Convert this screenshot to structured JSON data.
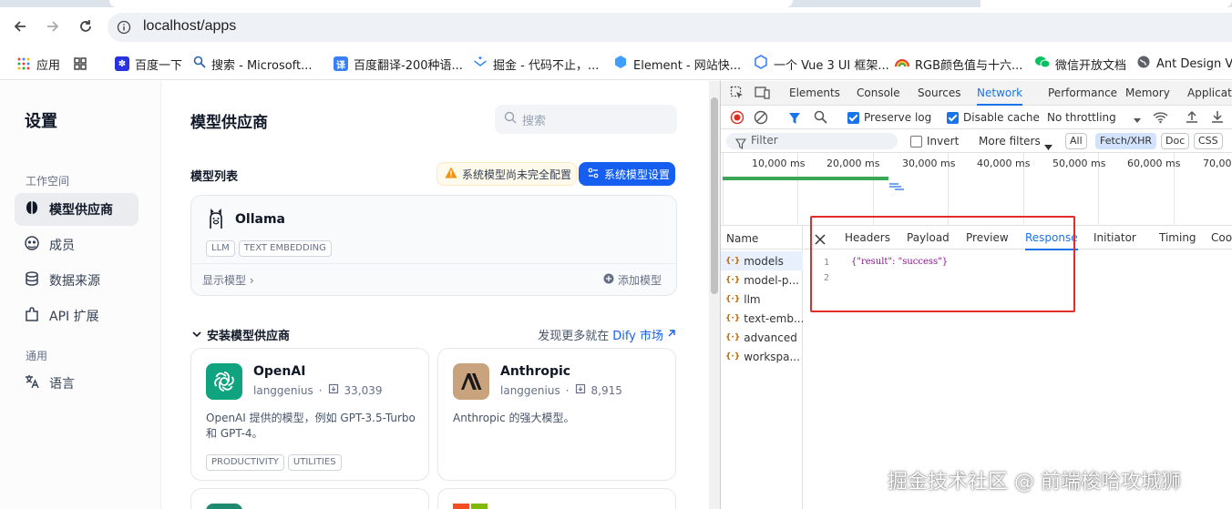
{
  "browser": {
    "url": "localhost/apps",
    "bookmarks": [
      "应用",
      "百度一下",
      "搜索 - Microsoft...",
      "百度翻译-200种语...",
      "掘金 - 代码不止，...",
      "Element - 网站快...",
      "一个 Vue 3 UI 框架...",
      "RGB颜色值与十六...",
      "微信开放文档",
      "Ant Design Vue"
    ]
  },
  "sidebar": {
    "title": "设置",
    "group_workspace": "工作空间",
    "items": [
      "模型供应商",
      "成员",
      "数据来源",
      "API 扩展"
    ],
    "group_general": "通用",
    "general_items": [
      "语言"
    ]
  },
  "main": {
    "title": "模型供应商",
    "search_placeholder": "搜索",
    "model_list_label": "模型列表",
    "warning_text": "系统模型尚未完全配置",
    "settings_button": "系统模型设置",
    "ollama": {
      "name": "Ollama",
      "tags": [
        "LLM",
        "TEXT EMBEDDING"
      ],
      "show_models": "显示模型",
      "add_model": "添加模型"
    },
    "install_label": "安装模型供应商",
    "discover_prefix": "发现更多就在",
    "discover_link": "Dify 市场",
    "providers": [
      {
        "name": "OpenAI",
        "author": "langgenius",
        "installs": "33,039",
        "desc": "OpenAI 提供的模型，例如 GPT-3.5-Turbo 和 GPT-4。",
        "tags": [
          "PRODUCTIVITY",
          "UTILITIES"
        ]
      },
      {
        "name": "Anthropic",
        "author": "langgenius",
        "installs": "8,915",
        "desc": "Anthropic 的强大模型。",
        "tags": []
      }
    ]
  },
  "devtools": {
    "tabs": [
      "Elements",
      "Console",
      "Sources",
      "Network",
      "Performance",
      "Memory",
      "Applicati"
    ],
    "active_tab": "Network",
    "preserve_log": "Preserve log",
    "disable_cache": "Disable cache",
    "throttling": "No throttling",
    "filter_placeholder": "Filter",
    "invert": "Invert",
    "more_filters": "More filters",
    "type_filters": [
      "All",
      "Fetch/XHR",
      "Doc",
      "CSS"
    ],
    "timeline_ticks": [
      "10,000 ms",
      "20,000 ms",
      "30,000 ms",
      "40,000 ms",
      "50,000 ms",
      "60,000 ms",
      "70,000"
    ],
    "name_header": "Name",
    "requests": [
      "models",
      "model-p...",
      "llm",
      "text-emb...",
      "advanced",
      "workspa..."
    ],
    "detail_tabs": [
      "Headers",
      "Payload",
      "Preview",
      "Response",
      "Initiator",
      "Timing",
      "Cook"
    ],
    "active_detail_tab": "Response",
    "response_lines": [
      "{\"result\": \"success\"}",
      ""
    ]
  },
  "watermark": "掘金技术社区 @ 前端梭哈攻城狮"
}
